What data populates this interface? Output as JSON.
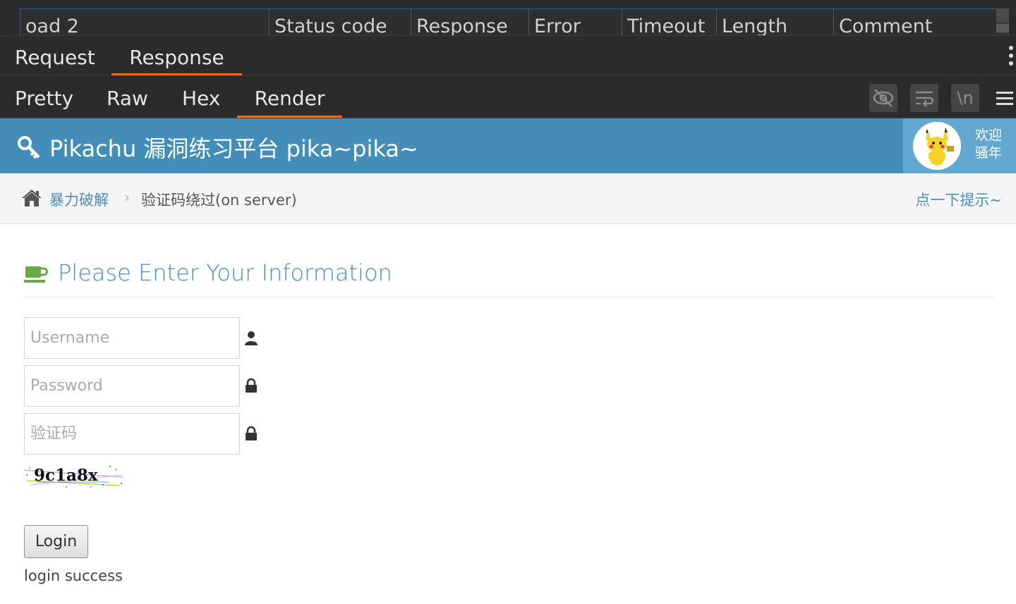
{
  "results_table": {
    "columns": [
      "oad 2",
      "Status code",
      "Response",
      "Error",
      "Timeout",
      "Length",
      "Comment"
    ]
  },
  "message_tabs": [
    {
      "label": "Request",
      "active": false
    },
    {
      "label": "Response",
      "active": true
    }
  ],
  "view_tabs": [
    {
      "label": "Pretty",
      "active": false
    },
    {
      "label": "Raw",
      "active": false
    },
    {
      "label": "Hex",
      "active": false
    },
    {
      "label": "Render",
      "active": true
    }
  ],
  "view_toolbar": {
    "icons": [
      "hide-eye-icon",
      "wrap-lines-icon",
      "newline-icon",
      "menu-icon"
    ],
    "newline_label": "\\n"
  },
  "page": {
    "brand": "Pikachu 漏洞练习平台 pika~pika~",
    "welcome": "欢迎骚年",
    "breadcrumb": {
      "parent": "暴力破解",
      "separator": "›",
      "current": "验证码绕过(on server)",
      "hint": "点一下提示~"
    },
    "form": {
      "title": "Please Enter Your Information",
      "username_placeholder": "Username",
      "password_placeholder": "Password",
      "captcha_placeholder": "验证码",
      "captcha_text": "9c1a8x",
      "login_label": "Login",
      "result": "login success"
    },
    "colors": {
      "navbar": "#438eb9",
      "link": "#4c8fbd",
      "title": "#478fca",
      "tab_accent": "#e8702a"
    }
  }
}
